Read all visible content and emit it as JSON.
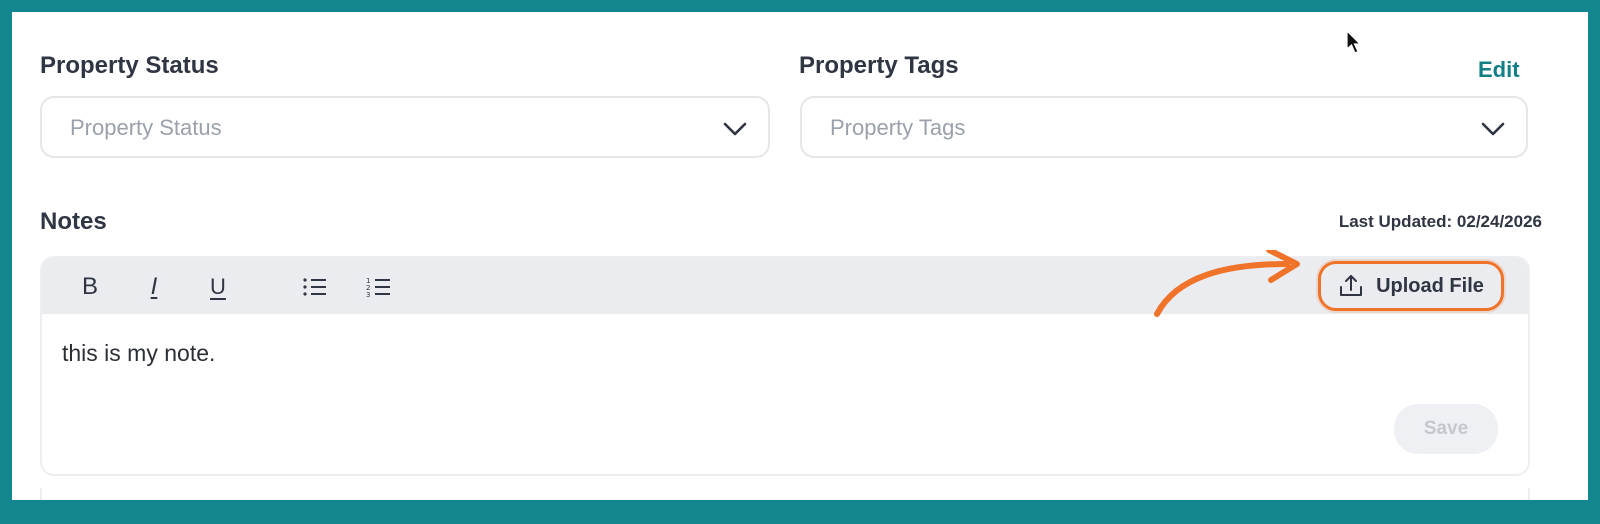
{
  "property_status": {
    "label": "Property Status",
    "placeholder": "Property Status",
    "chevron_icon": "chevron-down-icon"
  },
  "property_tags": {
    "label": "Property Tags",
    "placeholder": "Property Tags",
    "edit_label": "Edit",
    "chevron_icon": "chevron-down-icon"
  },
  "notes": {
    "label": "Notes",
    "last_updated": "Last Updated: 02/24/2026",
    "toolbar": {
      "bold_label": "B",
      "italic_label": "I",
      "underline_label": "U",
      "bullet_list_icon": "bullet-list-icon",
      "numbered_list_icon": "numbered-list-icon",
      "upload_icon": "upload-icon",
      "upload_label": "Upload File"
    },
    "content": "this is my note.",
    "save_label": "Save"
  },
  "colors": {
    "frame": "#148690",
    "accent": "#127f87",
    "highlight": "#f0732a",
    "toolbar_bg": "#ebecf0",
    "text": "#2f3542"
  }
}
